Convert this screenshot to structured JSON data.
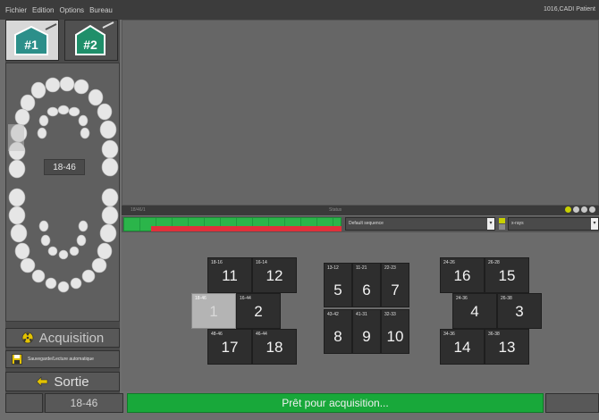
{
  "menu": {
    "items": [
      "Fichier",
      "Edition",
      "Options",
      "Bureau"
    ],
    "right": "1016,CADI Patient"
  },
  "tabs": [
    {
      "label": "#1",
      "active": true
    },
    {
      "label": "#2",
      "active": false
    }
  ],
  "tooth_label": "18-46",
  "buttons": {
    "acquisition": "Acquisition",
    "save": "Sauvegarde/Lecture automatique",
    "sortie": "Sortie"
  },
  "status": {
    "current_tooth": "18-46",
    "message": "Prêt pour acquisition..."
  },
  "sequence": {
    "label_left": "18/46/1",
    "label_mid": "Status",
    "default_sequence": "Default sequence",
    "type": "x-rays",
    "progress_green_fraction": 1.0,
    "progress_red_fraction": 0.88
  },
  "colors": {
    "accent_green": "#18a83a",
    "progress_red": "#e0303a",
    "tab2_icon": "#1f8f6a"
  },
  "groups": [
    {
      "cells": [
        {
          "sm": "18-16",
          "big": "11"
        },
        {
          "sm": "16-14",
          "big": "12"
        },
        {
          "sm": "18-46",
          "big": "1",
          "selected": true
        },
        {
          "sm": "16-44",
          "big": "2"
        },
        {
          "sm": "48-46",
          "big": "17"
        },
        {
          "sm": "46-44",
          "big": "18"
        }
      ]
    },
    {
      "cells": [
        {
          "sm": "13-12",
          "big": "5"
        },
        {
          "sm": "11-21",
          "big": "6"
        },
        {
          "sm": "22-23",
          "big": "7"
        },
        {
          "sm": "43-42",
          "big": "8"
        },
        {
          "sm": "41-31",
          "big": "9"
        },
        {
          "sm": "32-33",
          "big": "10"
        }
      ]
    },
    {
      "cells": [
        {
          "sm": "24-26",
          "big": "16"
        },
        {
          "sm": "26-28",
          "big": "15"
        },
        {
          "sm": "24-36",
          "big": "4"
        },
        {
          "sm": "26-38",
          "big": "3"
        },
        {
          "sm": "34-36",
          "big": "14"
        },
        {
          "sm": "36-38",
          "big": "13"
        }
      ]
    }
  ]
}
